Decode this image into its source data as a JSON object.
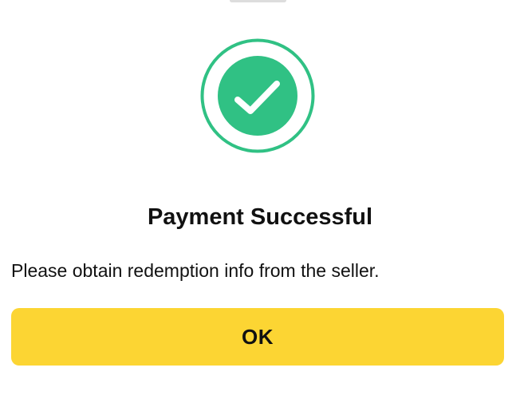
{
  "dialog": {
    "title": "Payment Successful",
    "message": "Please obtain redemption info from the seller.",
    "ok_label": "OK",
    "icon": "check-circle-icon"
  },
  "colors": {
    "accent_green": "#30c184",
    "button_yellow": "#fcd533",
    "text": "#111111",
    "handle": "#dddddd"
  }
}
